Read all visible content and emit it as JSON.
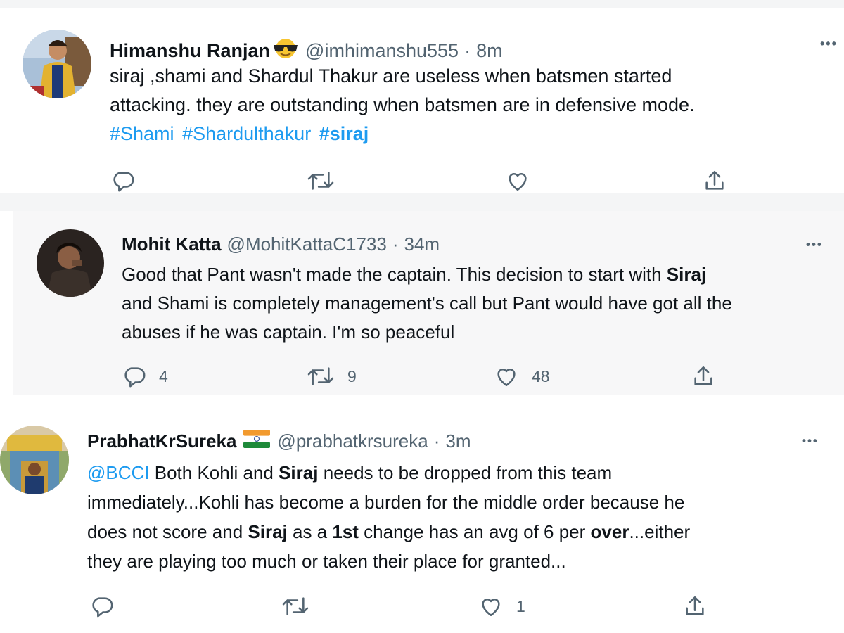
{
  "tweets": [
    {
      "name": "Himanshu Ranjan",
      "name_emoji": "smiling-face-with-sunglasses",
      "handle": "@imhimanshu555",
      "separator": "·",
      "time": "8m",
      "more": "•••",
      "text": {
        "line1": "siraj ,shami and Shardul Thakur are useless when batsmen started",
        "line2": "attacking. they are outstanding when batsmen are in defensive mode.",
        "hashtag1": "#Shami",
        "hashtag2": "#Shardulthakur",
        "hashtag3": "#siraj"
      },
      "counts": {
        "reply": "",
        "retweet": "",
        "like": ""
      }
    },
    {
      "name": "Mohit Katta",
      "handle": "@MohitKattaC1733",
      "separator": "·",
      "time": "34m",
      "more": "•••",
      "text": {
        "p1": "Good that Pant wasn't made the captain. This decision to start with ",
        "b1": "Siraj",
        "p2": "and Shami is completely management's call but Pant would have got all the",
        "p3": "abuses if he was captain. I'm so peaceful"
      },
      "counts": {
        "reply": "4",
        "retweet": "9",
        "like": "48"
      }
    },
    {
      "name": "PrabhatKrSureka",
      "name_flag": "india-flag",
      "handle": "@prabhatkrsureka",
      "separator": "·",
      "time": "3m",
      "more": "•••",
      "text": {
        "mention": "@BCCI",
        "p1": " Both Kohli and ",
        "b1": "Siraj",
        "p2": " needs to be dropped from this team",
        "p3": "immediately...Kohli has become a burden for the middle order because he",
        "p4": "does not score and ",
        "b2": "Siraj",
        "p5": " as a ",
        "b3": "1st",
        "p6": " change has an avg of 6 per ",
        "b4": "over",
        "p7": "...either",
        "p8": "they are playing too much or taken their place for granted..."
      },
      "counts": {
        "reply": "",
        "retweet": "",
        "like": "1"
      }
    }
  ],
  "icons": {
    "reply": "reply-icon",
    "retweet": "retweet-icon",
    "like": "heart-icon",
    "share": "share-icon"
  },
  "colors": {
    "link": "#1d9bf0",
    "secondary_text": "#536471",
    "primary_text": "#0f1419",
    "quoted_bg": "#f7f7f8"
  }
}
